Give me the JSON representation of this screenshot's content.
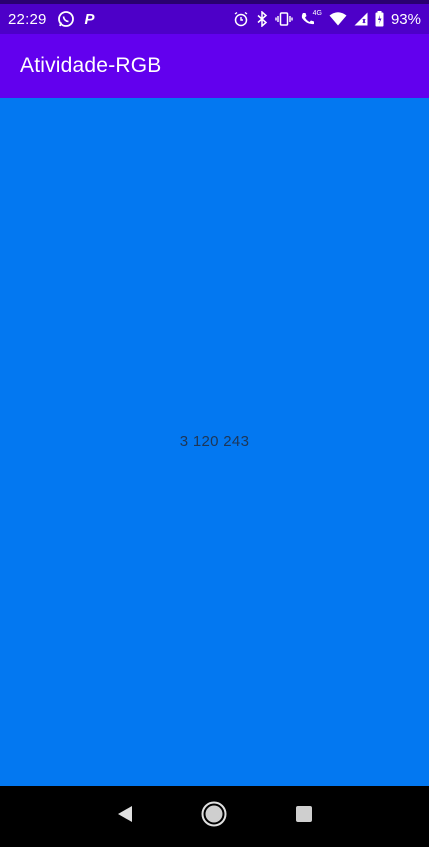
{
  "status_bar": {
    "time": "22:29",
    "battery": "93%",
    "icons_left": [
      "whatsapp-icon",
      "p-icon"
    ],
    "icons_right": [
      "alarm-icon",
      "bluetooth-icon",
      "vibrate-icon",
      "call-4g-icon",
      "wifi-icon",
      "signal-icon",
      "battery-icon"
    ],
    "p_letter": "P",
    "network_label": "4G"
  },
  "app_bar": {
    "title": "Atividade-RGB",
    "color": "#6200ee"
  },
  "content": {
    "rgb_text": "3 120 243",
    "background_color": "#0378f3"
  },
  "nav_bar": {
    "buttons": [
      "back-icon",
      "home-icon",
      "recents-icon"
    ]
  }
}
